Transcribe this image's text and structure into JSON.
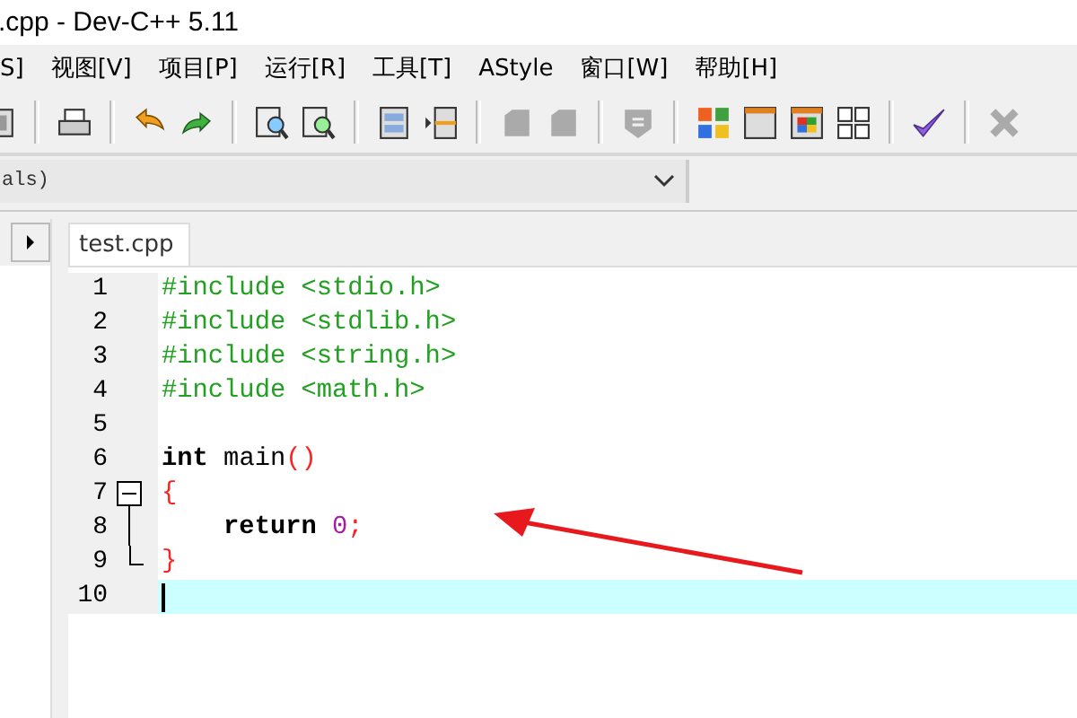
{
  "window": {
    "title": ".cpp - Dev-C++ 5.11"
  },
  "menu": [
    "S]",
    "视图[V]",
    "项目[P]",
    "运行[R]",
    "工具[T]",
    "AStyle",
    "窗口[W]",
    "帮助[H]"
  ],
  "scope_combo": {
    "value": "als)"
  },
  "tabs": [
    {
      "label": "test.cpp",
      "selected": true
    }
  ],
  "editor": {
    "lines": [
      {
        "number": "1",
        "current": false,
        "segments": [
          {
            "kind": "preproc",
            "text": "#include <stdio.h>"
          }
        ]
      },
      {
        "number": "2",
        "current": false,
        "segments": [
          {
            "kind": "preproc",
            "text": "#include <stdlib.h>"
          }
        ]
      },
      {
        "number": "3",
        "current": false,
        "segments": [
          {
            "kind": "preproc",
            "text": "#include <string.h>"
          }
        ]
      },
      {
        "number": "4",
        "current": false,
        "segments": [
          {
            "kind": "preproc",
            "text": "#include <math.h>"
          }
        ]
      },
      {
        "number": "5",
        "current": false
      },
      {
        "number": "6",
        "current": false,
        "segments": [
          {
            "kind": "keyword",
            "text": "int"
          },
          {
            "kind": "plain",
            "text": " main"
          },
          {
            "kind": "symbol",
            "text": "()"
          }
        ]
      },
      {
        "number": "7",
        "current": false,
        "fold_start": true,
        "segments": [
          {
            "kind": "symbol",
            "text": "{"
          }
        ]
      },
      {
        "number": "8",
        "current": false,
        "fold_inside": true,
        "segments": [
          {
            "kind": "keyword",
            "text": "    return "
          },
          {
            "kind": "number",
            "text": "0"
          },
          {
            "kind": "symbol",
            "text": ";"
          }
        ]
      },
      {
        "number": "9",
        "current": false,
        "fold_end": true,
        "segments": [
          {
            "kind": "symbol",
            "text": "}"
          }
        ]
      },
      {
        "number": "10",
        "current": true
      }
    ]
  }
}
